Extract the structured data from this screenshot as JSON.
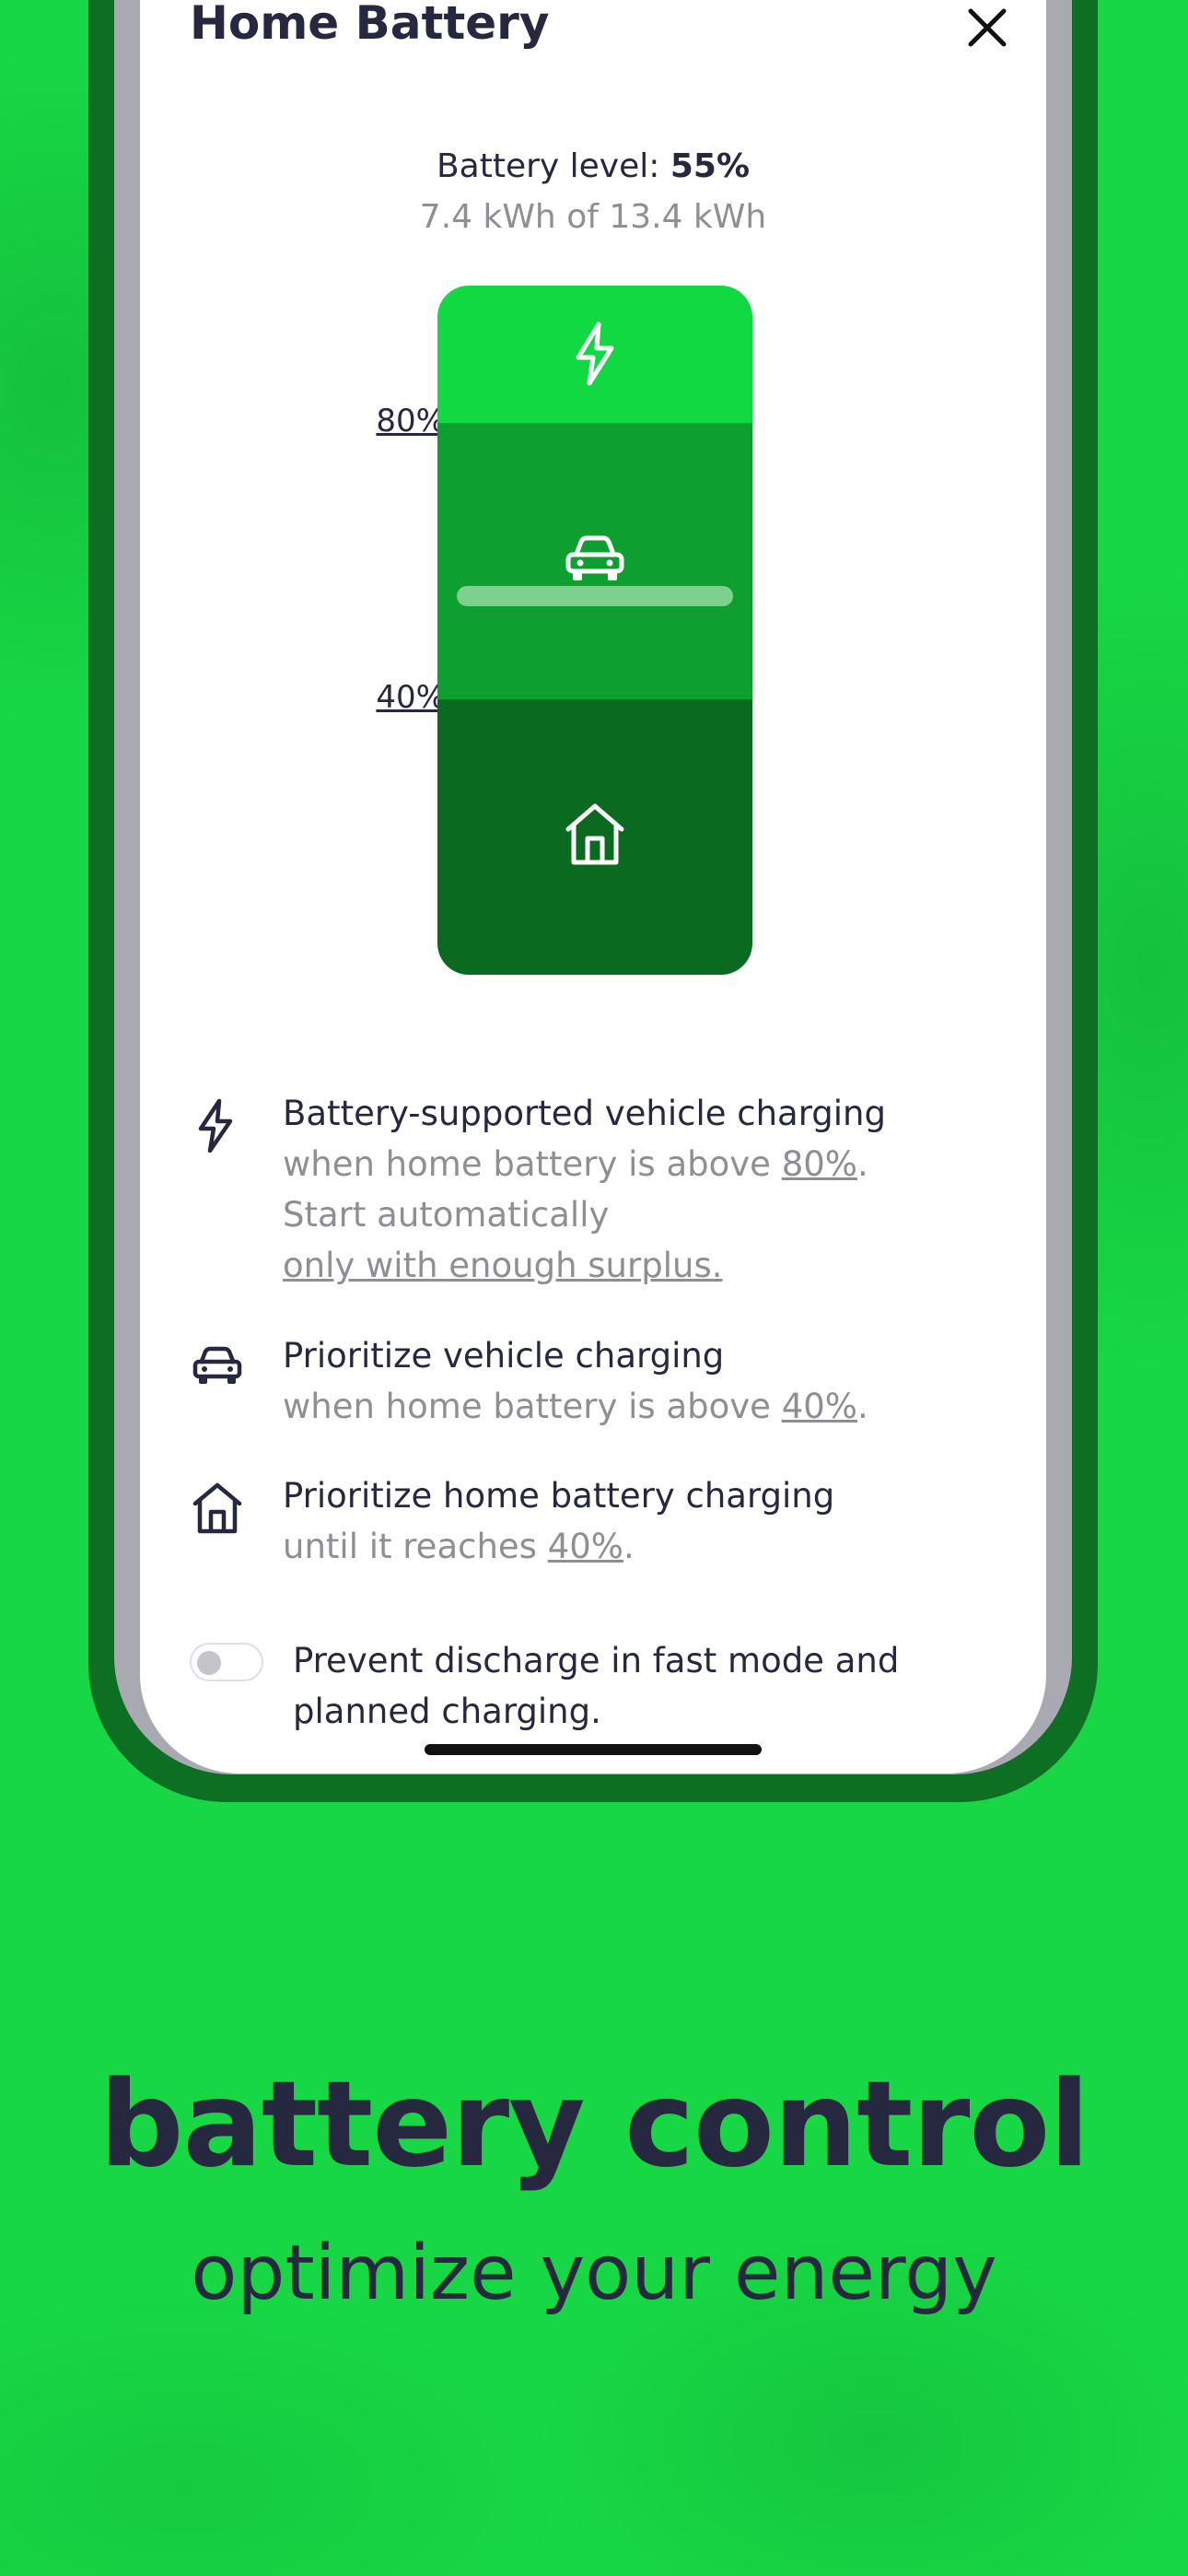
{
  "screen": {
    "title": "Home Battery",
    "battery_level_label": "Battery level: ",
    "battery_level_value": "55%",
    "battery_level_fraction": 0.55,
    "energy_text": "7.4 kWh of 13.4 kWh",
    "thresholds": {
      "upper": "80%",
      "lower": "40%"
    },
    "icons": {
      "close": "close-icon",
      "bolt": "bolt-icon",
      "car": "car-icon",
      "home": "home-icon"
    },
    "rules": [
      {
        "icon": "bolt-icon",
        "title": "Battery-supported vehicle charging",
        "line1_prefix": "when home battery is above ",
        "line1_link": "80%",
        "line1_suffix": ".",
        "line2": "Start automatically",
        "line3_link": "only with enough surplus."
      },
      {
        "icon": "car-icon",
        "title": "Prioritize vehicle charging",
        "line1_prefix": "when home battery is above ",
        "line1_link": "40%",
        "line1_suffix": "."
      },
      {
        "icon": "home-icon",
        "title": "Prioritize home battery charging",
        "line1_prefix": "until it reaches ",
        "line1_link": "40%",
        "line1_suffix": "."
      }
    ],
    "toggle": {
      "label": "Prevent discharge in fast mode and planned charging.",
      "on": false
    }
  },
  "marketing": {
    "headline": "battery control",
    "subline": "optimize your energy"
  },
  "colors": {
    "background": "#17d744",
    "text_dark": "#262840",
    "text_muted": "#8e8e95",
    "zone_top": "#11d941",
    "zone_mid": "#0da030",
    "zone_bottom": "#096a20"
  }
}
